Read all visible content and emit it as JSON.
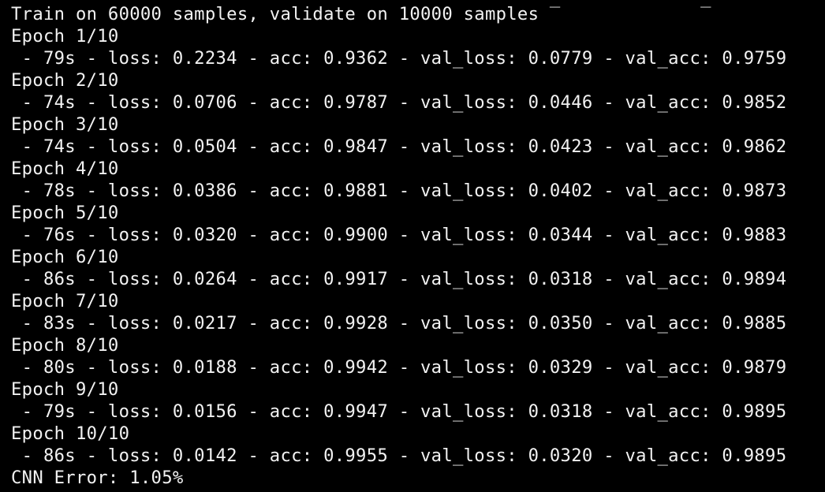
{
  "terminal": {
    "cutoff_line": "                                                  _             _",
    "header": "Train on 60000 samples, validate on 10000 samples",
    "epochs": [
      {
        "label": "Epoch 1/10",
        "stats": " - 79s - loss: 0.2234 - acc: 0.9362 - val_loss: 0.0779 - val_acc: 0.9759"
      },
      {
        "label": "Epoch 2/10",
        "stats": " - 74s - loss: 0.0706 - acc: 0.9787 - val_loss: 0.0446 - val_acc: 0.9852"
      },
      {
        "label": "Epoch 3/10",
        "stats": " - 74s - loss: 0.0504 - acc: 0.9847 - val_loss: 0.0423 - val_acc: 0.9862"
      },
      {
        "label": "Epoch 4/10",
        "stats": " - 78s - loss: 0.0386 - acc: 0.9881 - val_loss: 0.0402 - val_acc: 0.9873"
      },
      {
        "label": "Epoch 5/10",
        "stats": " - 76s - loss: 0.0320 - acc: 0.9900 - val_loss: 0.0344 - val_acc: 0.9883"
      },
      {
        "label": "Epoch 6/10",
        "stats": " - 86s - loss: 0.0264 - acc: 0.9917 - val_loss: 0.0318 - val_acc: 0.9894"
      },
      {
        "label": "Epoch 7/10",
        "stats": " - 83s - loss: 0.0217 - acc: 0.9928 - val_loss: 0.0350 - val_acc: 0.9885"
      },
      {
        "label": "Epoch 8/10",
        "stats": " - 80s - loss: 0.0188 - acc: 0.9942 - val_loss: 0.0329 - val_acc: 0.9879"
      },
      {
        "label": "Epoch 9/10",
        "stats": " - 79s - loss: 0.0156 - acc: 0.9947 - val_loss: 0.0318 - val_acc: 0.9895"
      },
      {
        "label": "Epoch 10/10",
        "stats": " - 86s - loss: 0.0142 - acc: 0.9955 - val_loss: 0.0320 - val_acc: 0.9895"
      }
    ],
    "footer": "CNN Error: 1.05%"
  },
  "colors": {
    "background": "#000000",
    "text": "#f2f2f2"
  }
}
